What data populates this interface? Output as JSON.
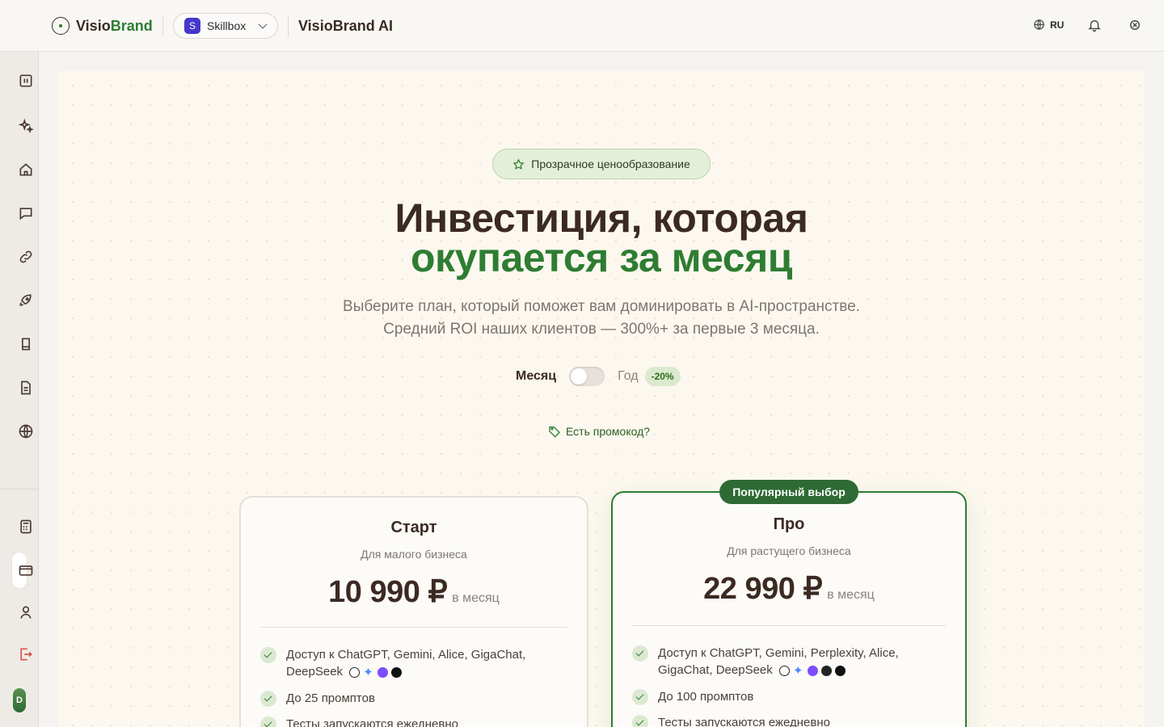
{
  "app": {
    "logo_prefix": "Visio",
    "logo_accent": "Brand",
    "workspace_badge": "S",
    "workspace_name": "Skillbox",
    "title": "VisioBrand AI",
    "language": "RU",
    "avatar_letter": "D"
  },
  "sidebar": {
    "items": [
      "dashboard-icon",
      "sparkles-icon",
      "home-icon",
      "chat-icon",
      "link-icon",
      "rocket-icon",
      "bookmark-icon",
      "document-icon",
      "globe-icon"
    ],
    "bottom": [
      "calculator-icon",
      "card-icon",
      "user-icon",
      "logout-icon"
    ]
  },
  "hero": {
    "tag": "Прозрачное ценообразование",
    "title_line1": "Инвестиция, которая",
    "title_line2": "окупается за месяц",
    "subtitle_line1": "Выберите план, который поможет вам доминировать в AI-пространстве.",
    "subtitle_line2": "Средний ROI наших клиентов — 300%+ за первые 3 месяца."
  },
  "billing": {
    "month_label": "Месяц",
    "year_label": "Год",
    "discount": "-20%",
    "yearly_selected": false
  },
  "promo": {
    "label": "Есть промокод?"
  },
  "plans": [
    {
      "name": "Старт",
      "description": "Для малого бизнеса",
      "price": "10 990 ₽",
      "period": "в месяц",
      "features": [
        "Доступ к ChatGPT, Gemini, Alice, GigaChat,",
        "DeepSeek",
        "До 25 промптов",
        "Тесты запускаются ежедневно"
      ]
    },
    {
      "name": "Про",
      "badge": "Популярный выбор",
      "description": "Для растущего бизнеса",
      "price": "22 990 ₽",
      "period": "в месяц",
      "features": [
        "Доступ к ChatGPT, Gemini, Perplexity, Alice,",
        "GigaChat, DeepSeek",
        "До 100 промптов",
        "Тесты запускаются ежедневно"
      ]
    }
  ],
  "colors": {
    "accent": "#2e7d32",
    "heading": "#3b2a22",
    "background": "#fcf8ef"
  }
}
